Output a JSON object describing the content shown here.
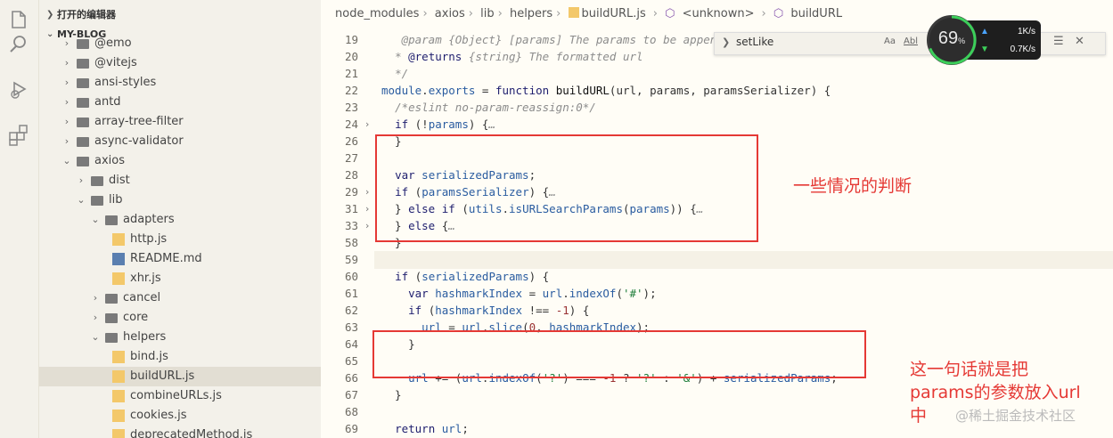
{
  "sidebar": {
    "open_editors_label": "打开的编辑器",
    "project_label": "MY-BLOG",
    "tree": [
      {
        "label": "@emo",
        "depth": 1,
        "kind": "folder",
        "open": false
      },
      {
        "label": "@vitejs",
        "depth": 1,
        "kind": "folder",
        "open": false
      },
      {
        "label": "ansi-styles",
        "depth": 1,
        "kind": "folder",
        "open": false
      },
      {
        "label": "antd",
        "depth": 1,
        "kind": "folder",
        "open": false
      },
      {
        "label": "array-tree-filter",
        "depth": 1,
        "kind": "folder",
        "open": false
      },
      {
        "label": "async-validator",
        "depth": 1,
        "kind": "folder",
        "open": false
      },
      {
        "label": "axios",
        "depth": 1,
        "kind": "folder",
        "open": true
      },
      {
        "label": "dist",
        "depth": 2,
        "kind": "folder",
        "open": false
      },
      {
        "label": "lib",
        "depth": 2,
        "kind": "folder",
        "open": true
      },
      {
        "label": "adapters",
        "depth": 3,
        "kind": "folder",
        "open": true
      },
      {
        "label": "http.js",
        "depth": 4,
        "kind": "js"
      },
      {
        "label": "README.md",
        "depth": 4,
        "kind": "md"
      },
      {
        "label": "xhr.js",
        "depth": 4,
        "kind": "js"
      },
      {
        "label": "cancel",
        "depth": 3,
        "kind": "folder",
        "open": false
      },
      {
        "label": "core",
        "depth": 3,
        "kind": "folder",
        "open": false
      },
      {
        "label": "helpers",
        "depth": 3,
        "kind": "folder",
        "open": true
      },
      {
        "label": "bind.js",
        "depth": 4,
        "kind": "js"
      },
      {
        "label": "buildURL.js",
        "depth": 4,
        "kind": "js",
        "selected": true
      },
      {
        "label": "combineURLs.js",
        "depth": 4,
        "kind": "js"
      },
      {
        "label": "cookies.js",
        "depth": 4,
        "kind": "js"
      },
      {
        "label": "deprecatedMethod.js",
        "depth": 4,
        "kind": "js"
      }
    ]
  },
  "breadcrumb": {
    "items": [
      "node_modules",
      "axios",
      "lib",
      "helpers",
      "buildURL.js",
      "<unknown>",
      "buildURL"
    ]
  },
  "find": {
    "query": "setLike",
    "opt_case": "Aa",
    "opt_word": "Abl"
  },
  "perf_widget": {
    "percent": "69",
    "percent_sign": "%",
    "upload": "1K/s",
    "download": "0.7K/s",
    "up_color": "#4aa3ff",
    "down_color": "#3ccf5a"
  },
  "code_lines": [
    {
      "n": "19",
      "html": "   <span class='cm'>@param {Object} [params] The params to be appended</span>"
    },
    {
      "n": "20",
      "html": "  <span class='cm'>* </span><span class='kw'>@returns</span> <span class='cm'>{string} The formatted url</span>"
    },
    {
      "n": "21",
      "html": "  <span class='cm'>*/</span>"
    },
    {
      "n": "22",
      "html": "<span class='vr'>module</span>.<span class='vr'>exports</span> = <span class='kw'>function</span> <span class='fn'>buildURL</span>(url, params, paramsSerializer) {"
    },
    {
      "n": "23",
      "html": "  <span class='cm'>/*eslint no-param-reassign:0*/</span>"
    },
    {
      "n": "24",
      "html": "  <span class='kw'>if</span> (!<span class='vr'>params</span>) {<span class='cm'>…</span>",
      "fold": true
    },
    {
      "n": "26",
      "html": "  }"
    },
    {
      "n": "27",
      "html": ""
    },
    {
      "n": "28",
      "html": "  <span class='kw'>var</span> <span class='vr'>serializedParams</span>;"
    },
    {
      "n": "29",
      "html": "  <span class='kw'>if</span> (<span class='vr'>paramsSerializer</span>) {<span class='cm'>…</span>",
      "fold": true
    },
    {
      "n": "31",
      "html": "  } <span class='kw'>else if</span> (<span class='vr'>utils</span>.<span class='vr'>isURLSearchParams</span>(<span class='vr'>params</span>)) {<span class='cm'>…</span>",
      "fold": true
    },
    {
      "n": "33",
      "html": "  } <span class='kw'>else</span> {<span class='cm'>…</span>",
      "fold": true
    },
    {
      "n": "58",
      "html": "  }"
    },
    {
      "n": "59",
      "html": ""
    },
    {
      "n": "60",
      "html": "  <span class='kw'>if</span> (<span class='vr'>serializedParams</span>) {"
    },
    {
      "n": "61",
      "html": "    <span class='kw'>var</span> <span class='vr'>hashmarkIndex</span> = <span class='vr'>url</span>.<span class='vr'>indexOf</span>(<span class='st'>'#'</span>);"
    },
    {
      "n": "62",
      "html": "    <span class='kw'>if</span> (<span class='vr'>hashmarkIndex</span> !== <span class='nm'>-1</span>) {"
    },
    {
      "n": "63",
      "html": "      <span class='vr'>url</span> = <span class='vr'>url</span>.<span class='vr'>slice</span>(<span class='nm'>0</span>, <span class='vr'>hashmarkIndex</span>);"
    },
    {
      "n": "64",
      "html": "    }"
    },
    {
      "n": "65",
      "html": ""
    },
    {
      "n": "66",
      "html": "    <span class='vr'>url</span> += (<span class='vr'>url</span>.<span class='vr'>indexOf</span>(<span class='st'>'?'</span>) === <span class='nm'>-1</span> ? <span class='st'>'?'</span> : <span class='st'>'&amp;'</span>) + <span class='vr'>serializedParams</span>;"
    },
    {
      "n": "67",
      "html": "  }"
    },
    {
      "n": "68",
      "html": ""
    },
    {
      "n": "69",
      "html": "  <span class='kw'>return</span> <span class='vr'>url</span>;"
    },
    {
      "n": "70",
      "html": "};"
    }
  ],
  "annotations": {
    "note1": "一些情况的判断",
    "note2_line1": "这一句话就是把",
    "note2_line2": "params的参数放入url",
    "note2_line3": "中",
    "box_color": "#e53935"
  },
  "watermark": "@稀土掘金技术社区"
}
